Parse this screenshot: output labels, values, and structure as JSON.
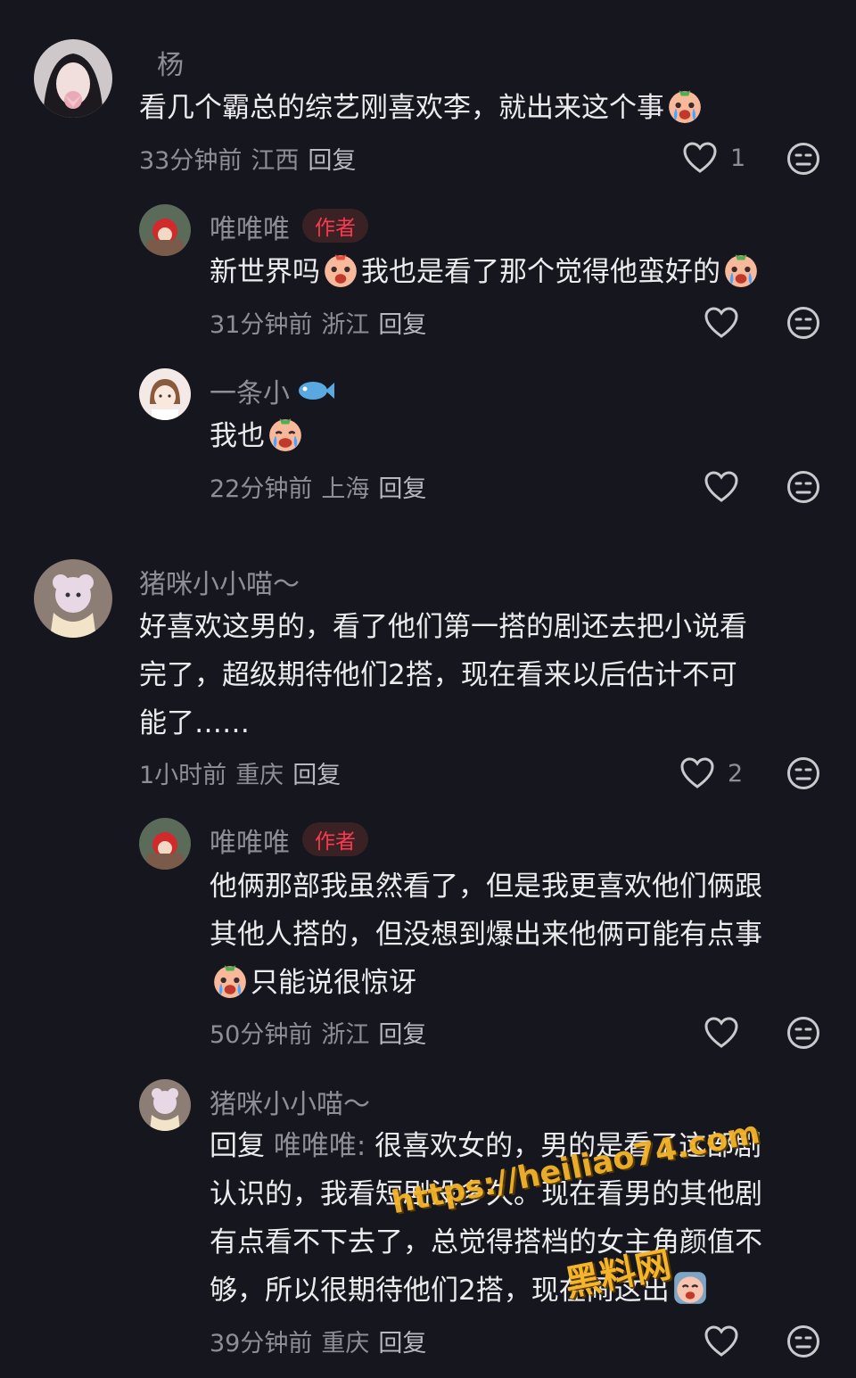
{
  "comments": [
    {
      "name": "杨",
      "text_lines": [
        "看几个霸总的综艺刚喜欢李，就出来这个事"
      ],
      "time": "33分钟前",
      "location": "江西",
      "reply": "回复",
      "likes": "1",
      "replies": [
        {
          "name": "唯唯唯",
          "badge": "作者",
          "text_lines": [
            "新世界吗",
            "我也是看了那个觉得他蛮好的"
          ],
          "time": "31分钟前",
          "location": "浙江",
          "reply": "回复"
        },
        {
          "name": "一条小",
          "text_lines": [
            "我也"
          ],
          "time": "22分钟前",
          "location": "上海",
          "reply": "回复"
        }
      ]
    },
    {
      "name": "猪咪小小喵～",
      "text_lines": [
        "好喜欢这男的，看了他们第一搭的剧还去把小说看",
        "完了，超级期待他们2搭，现在看来以后估计不可",
        "能了……"
      ],
      "time": "1小时前",
      "location": "重庆",
      "reply": "回复",
      "likes": "2",
      "replies": [
        {
          "name": "唯唯唯",
          "badge": "作者",
          "text_lines": [
            "他俩那部我虽然看了，但是我更喜欢他们俩跟",
            "其他人搭的，但没想到爆出来他俩可能有点事",
            "只能说很惊讶"
          ],
          "time": "50分钟前",
          "location": "浙江",
          "reply": "回复"
        },
        {
          "name": "猪咪小小喵～",
          "reply_prefix": "回复",
          "reply_target": "唯唯唯:",
          "text_lines": [
            "很喜欢女的，男的是看了这部剧",
            "认识的，我看短剧没多久。现在看男的其他剧",
            "有点看不下去了，总觉得搭档的女主角颜值不",
            "够，所以很期待他们2搭，现在闹这出"
          ],
          "time": "39分钟前",
          "location": "重庆",
          "reply": "回复"
        }
      ]
    }
  ],
  "watermark": {
    "url": "https://heiliao74.com",
    "site": "黑料网"
  },
  "colors": {
    "background": "#16161e",
    "text": "#ececef",
    "muted": "#8e8e96",
    "badge": "#fa3a4f"
  },
  "icons": [
    "heart-icon",
    "dislike-face-icon",
    "crying-emoji-icon",
    "fish-emoji-icon"
  ]
}
